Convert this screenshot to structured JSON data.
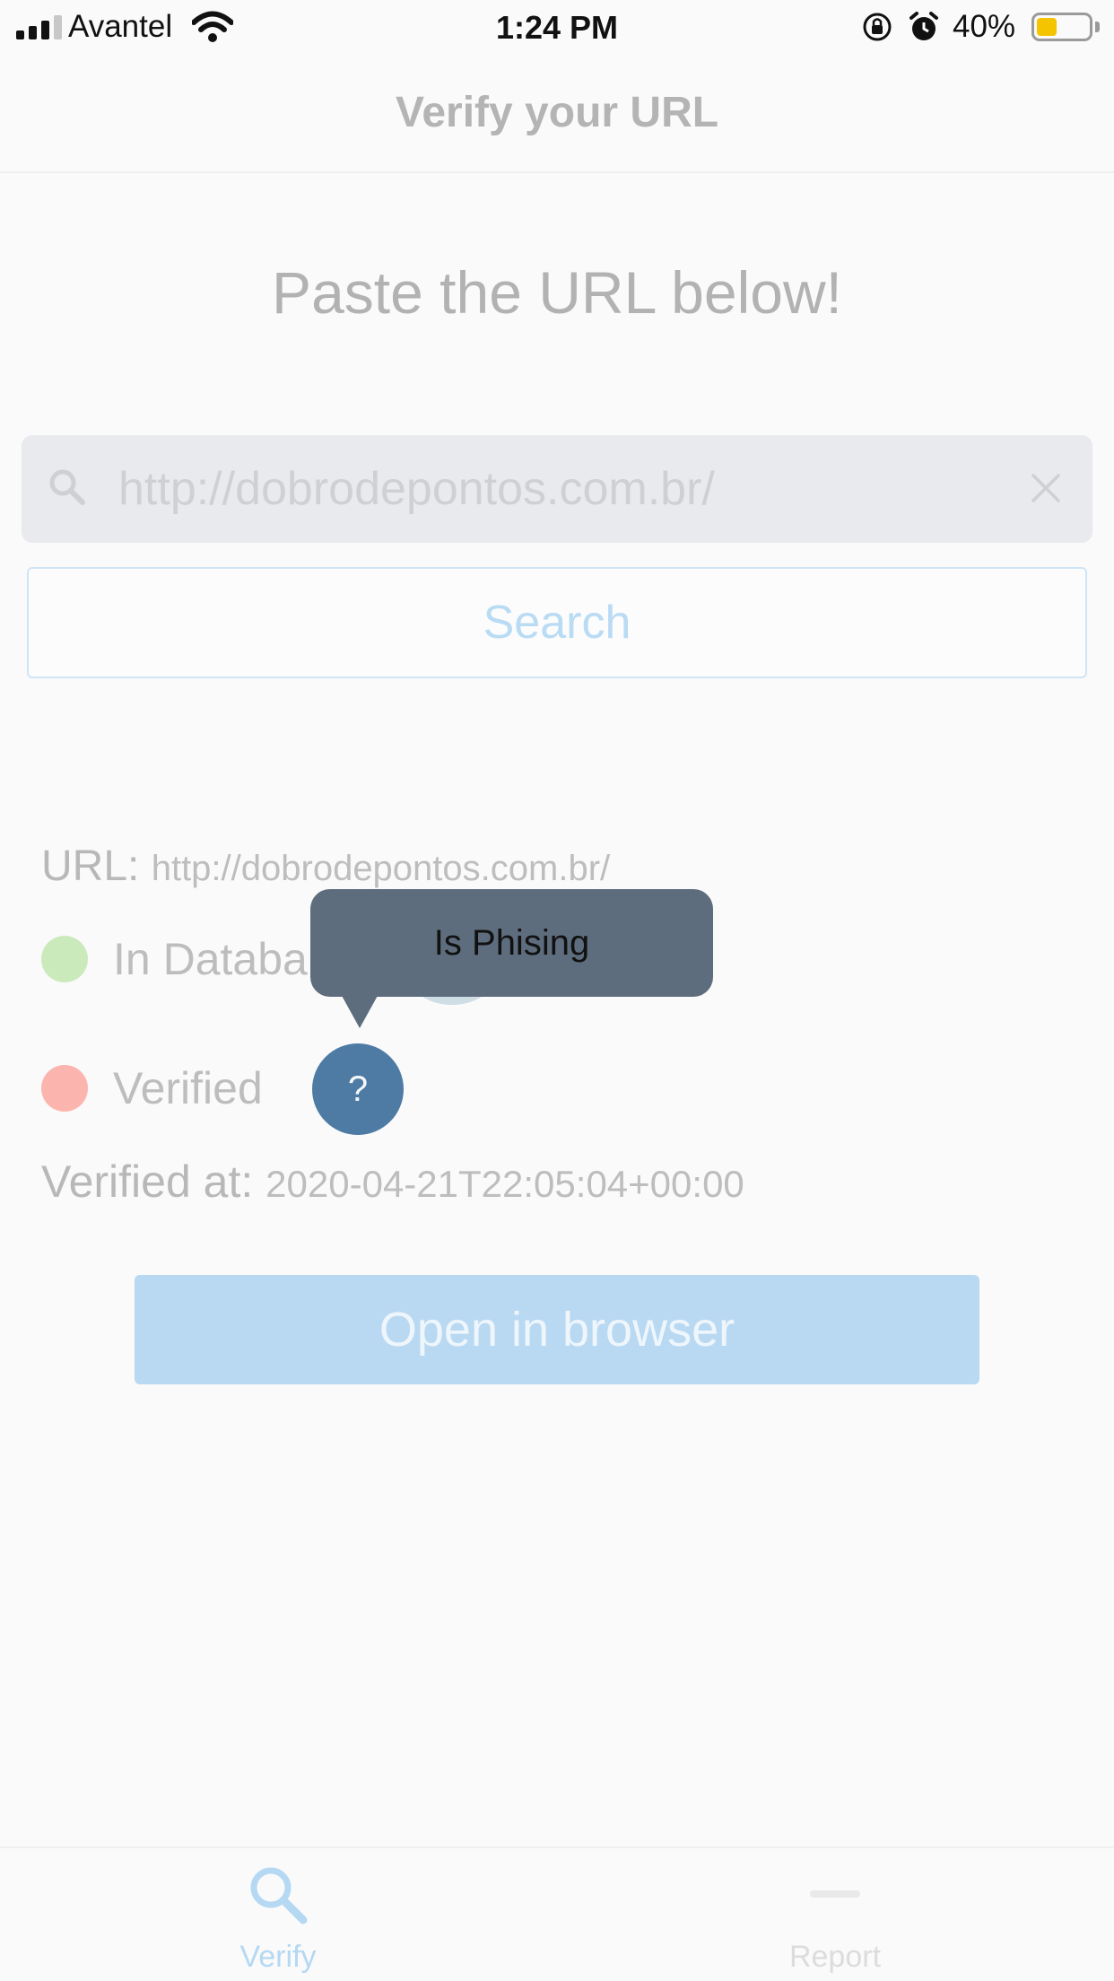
{
  "status_bar": {
    "carrier": "Avantel",
    "time": "1:24 PM",
    "battery_percent": "40%",
    "battery_level": 0.4,
    "battery_color": "#f5c400"
  },
  "nav": {
    "title": "Verify your URL"
  },
  "main": {
    "heading": "Paste the URL below!",
    "search": {
      "value": "http://dobrodepontos.com.br/",
      "placeholder": ""
    },
    "search_button": "Search",
    "result": {
      "url_label": "URL:",
      "url_value": "http://dobrodepontos.com.br/",
      "in_database_label": "In Databa",
      "verified_label": "Verified",
      "verified_at_label": "Verified at:",
      "verified_at_value": "2020-04-21T22:05:04+00:00",
      "status_colors": {
        "in_database": "#cbeabb",
        "verified": "#fbb5ae"
      }
    },
    "open_button": "Open in browser"
  },
  "tooltip": {
    "text": "Is Phising",
    "help_button": "?"
  },
  "tabbar": {
    "tabs": [
      {
        "label": "Verify",
        "icon": "search-icon",
        "active": true
      },
      {
        "label": "Report",
        "icon": "minus-icon",
        "active": false
      }
    ]
  },
  "colors": {
    "accent": "#b9d9f2",
    "tooltip_bg": "#5e6d7d",
    "help_button": "#4d7ba4"
  }
}
